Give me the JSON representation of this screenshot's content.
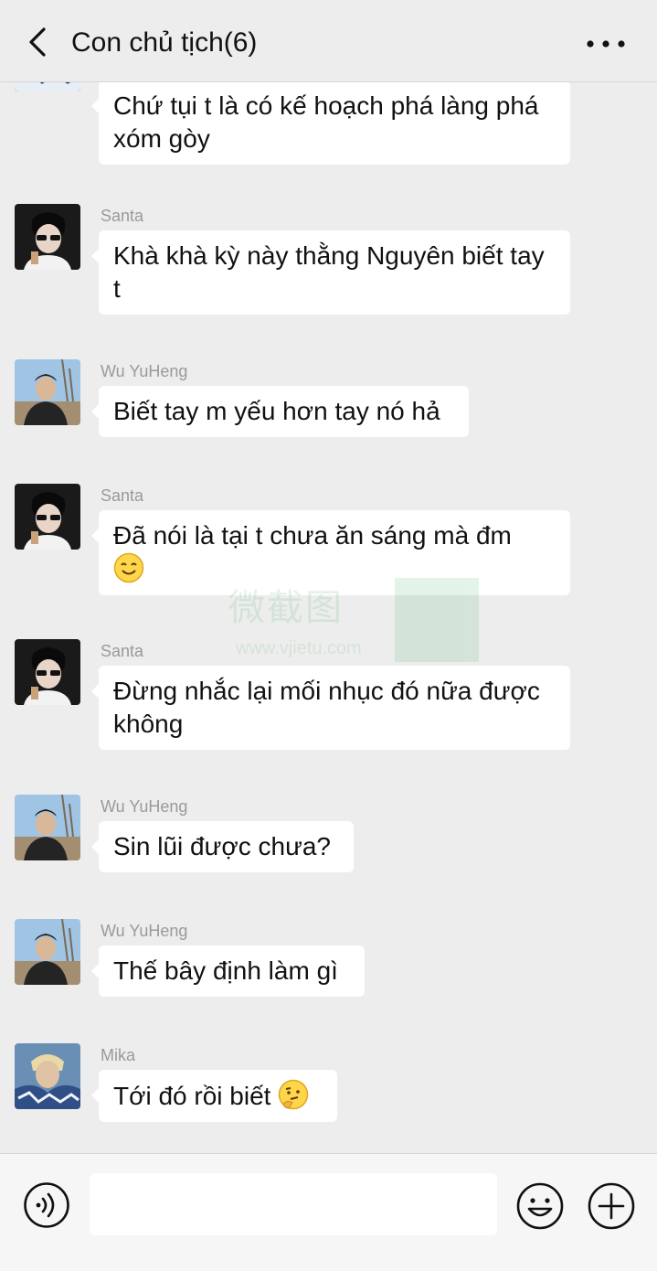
{
  "header": {
    "title": "Con chủ tịch(6)",
    "back_icon": "chevron-left-icon",
    "more_icon": "more-dots-icon"
  },
  "messages": [
    {
      "sender": "",
      "text": "Chứ tụi t là có kế hoạch phá làng phá xóm gòy",
      "avatar": "mika-avatar"
    },
    {
      "sender": "Santa",
      "text": "Khà khà kỳ này thằng Nguyên biết tay t",
      "avatar": "santa-avatar"
    },
    {
      "sender": "Wu YuHeng",
      "text": "Biết tay m yếu hơn tay nó hả",
      "avatar": "wu-avatar"
    },
    {
      "sender": "Santa",
      "text": "Đã nói là tại t chưa ăn sáng mà đm",
      "emoji": "smile-emoji",
      "avatar": "santa-avatar"
    },
    {
      "sender": "Santa",
      "text": "Đừng nhắc lại mối nhục đó nữa được không",
      "avatar": "santa-avatar"
    },
    {
      "sender": "Wu YuHeng",
      "text": "Sin lũi được chưa?",
      "avatar": "wu-avatar"
    },
    {
      "sender": "Wu YuHeng",
      "text": "Thế bây định làm gì",
      "avatar": "wu-avatar"
    },
    {
      "sender": "Mika",
      "text": "Tới đó rồi biết",
      "emoji": "thinking-emoji",
      "avatar": "mika-avatar"
    }
  ],
  "watermark": {
    "text": "微截图",
    "url": "www.vjietu.com"
  },
  "bottom_bar": {
    "input_placeholder": "",
    "voice_icon": "voice-icon",
    "emoji_icon": "smiley-face-icon",
    "plus_icon": "plus-circle-icon"
  },
  "colors": {
    "background": "#ededed",
    "bubble": "#ffffff",
    "sender": "#9a9a9a"
  }
}
